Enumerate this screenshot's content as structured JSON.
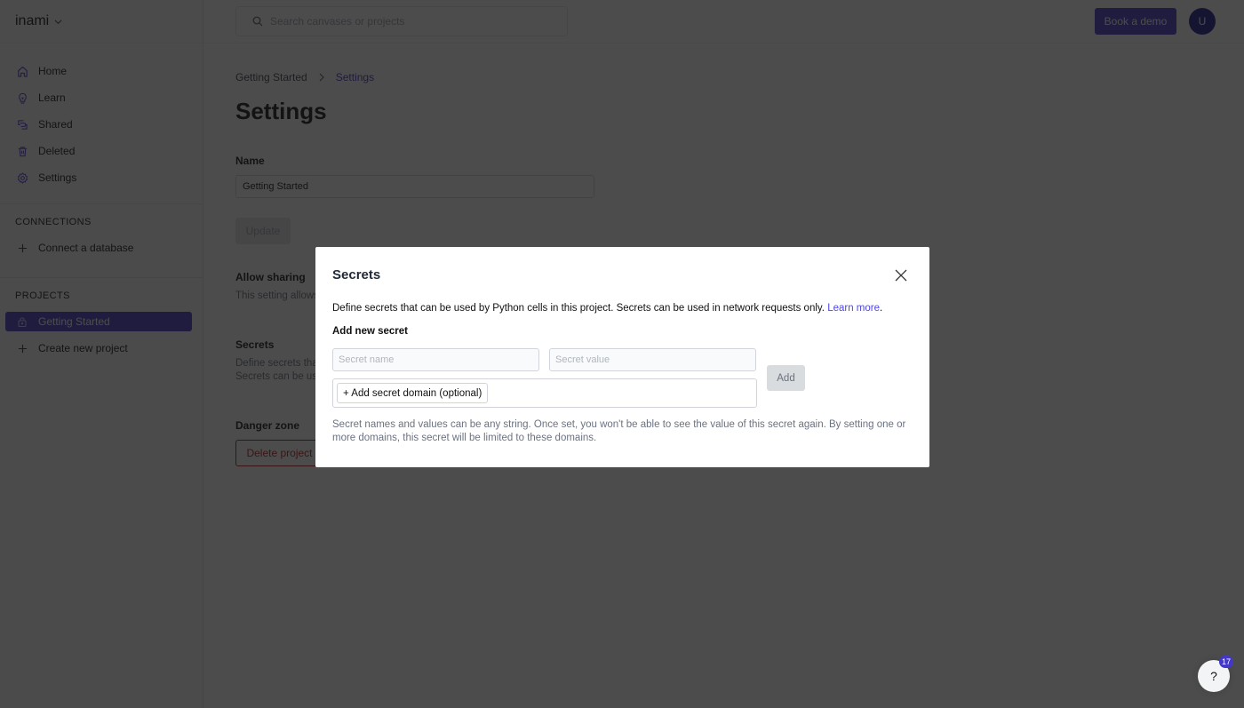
{
  "brand": {
    "name": "inami"
  },
  "sidebar": {
    "nav": [
      {
        "label": "Home",
        "icon": "home-icon"
      },
      {
        "label": "Learn",
        "icon": "lightbulb-icon"
      },
      {
        "label": "Shared",
        "icon": "shared-icon"
      },
      {
        "label": "Deleted",
        "icon": "trash-icon"
      },
      {
        "label": "Settings",
        "icon": "gear-icon"
      }
    ],
    "connections": {
      "title": "CONNECTIONS",
      "items": [
        {
          "label": "Connect a database",
          "icon": "plus-icon"
        }
      ]
    },
    "projects": {
      "title": "PROJECTS",
      "items": [
        {
          "label": "Getting Started",
          "icon": "lock-icon",
          "active": true
        },
        {
          "label": "Create new project",
          "icon": "plus-icon"
        }
      ]
    }
  },
  "topbar": {
    "search_placeholder": "Search canvases or projects",
    "demo_label": "Book a demo",
    "avatar_initial": "U"
  },
  "page": {
    "breadcrumb": [
      "Getting Started",
      "Settings"
    ],
    "title": "Settings",
    "name_label": "Name",
    "name_value": "Getting Started",
    "update_label": "Update",
    "allow_sharing": {
      "title": "Allow sharing",
      "desc": "This setting allows canvases to share"
    },
    "secrets": {
      "title": "Secrets",
      "desc": "Define secrets that can be used by Python cells in this project. Secrets can be used in network requests only."
    },
    "danger": {
      "title": "Danger zone",
      "delete_label": "Delete project"
    }
  },
  "modal": {
    "title": "Secrets",
    "description": "Define secrets that can be used by Python cells in this project. Secrets can be used in network requests only. ",
    "learn_more": "Learn more",
    "add_label": "Add new secret",
    "name_placeholder": "Secret name",
    "value_placeholder": "Secret value",
    "domain_button": "+ Add secret domain (optional)",
    "add_button": "Add",
    "note": "Secret names and values can be any string. Once set, you won't be able to see the value of this secret again. By setting one or more domains, this secret will be limited to these domains."
  },
  "help": {
    "label": "?",
    "badge": "17"
  },
  "colors": {
    "accent": "#4338ca",
    "danger": "#b91c1c",
    "link": "#4f46e5"
  }
}
